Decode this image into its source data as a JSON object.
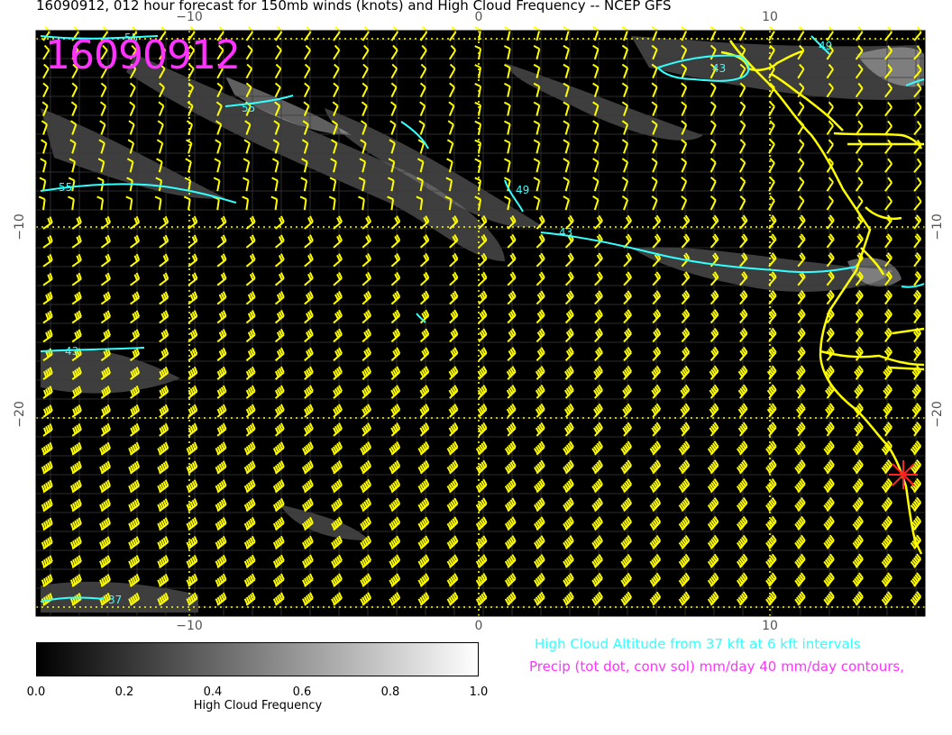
{
  "title": "16090912, 012 hour forecast for 150mb winds (knots) and High Cloud Frequency -- NCEP GFS",
  "date_stamp": "16090912",
  "axes": {
    "top": [
      "−10",
      "0",
      "10"
    ],
    "bottom": [
      "−10",
      "0",
      "10"
    ],
    "left": [
      "−10",
      "−20"
    ],
    "right": [
      "−10",
      "−20"
    ]
  },
  "contour_labels": [
    "55",
    "55",
    "55",
    "49",
    "49",
    "43",
    "43",
    "43",
    "37"
  ],
  "colorbar": {
    "label": "High Cloud Frequency",
    "ticks": [
      "0.0",
      "0.2",
      "0.4",
      "0.6",
      "0.8",
      "1.0"
    ],
    "range": [
      0.0,
      1.0
    ]
  },
  "notes": {
    "cloud_altitude": "High Cloud Altitude from 37 kft at 6 kft intervals",
    "precip": "Precip (tot dot, conv sol) mm/day 40 mm/day contours,"
  },
  "colors": {
    "background": "#000000",
    "wind_barbs": "#ffff00",
    "coastline": "#ffff00",
    "cloud_altitude_contours": "#33ffff",
    "precip_text": "#ff33ff",
    "marker": "#ff2222"
  },
  "icons": [
    "wind-barb-icon",
    "star-marker-icon"
  ]
}
